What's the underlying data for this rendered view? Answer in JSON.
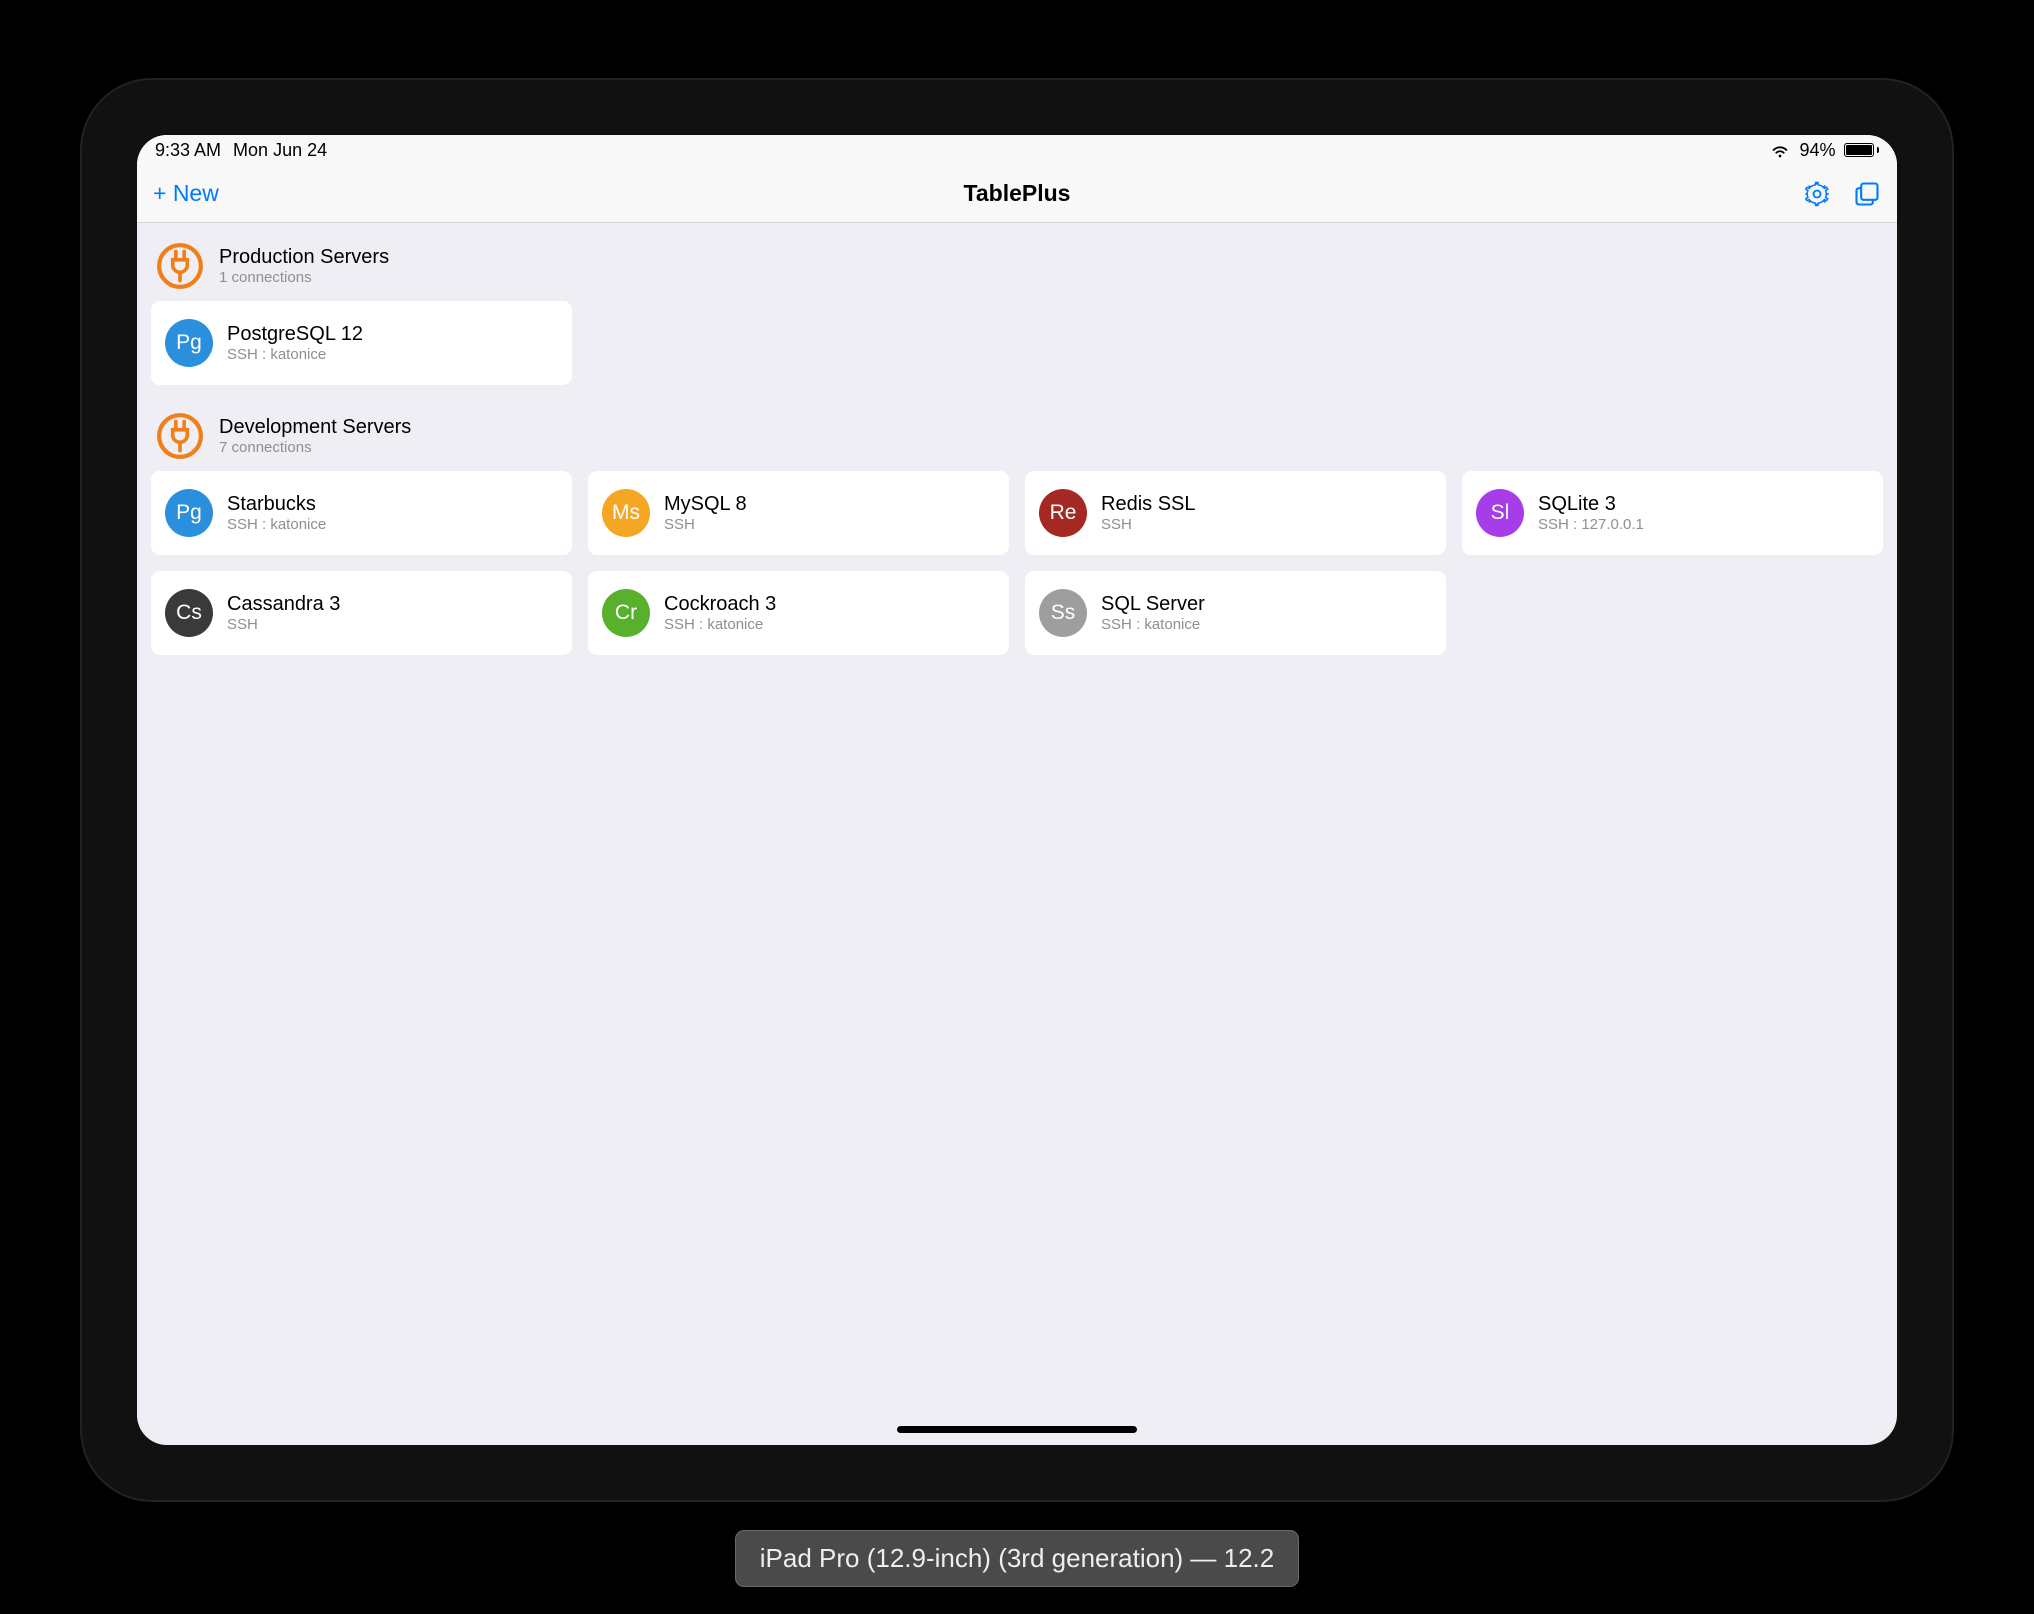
{
  "status": {
    "time": "9:33 AM",
    "date": "Mon Jun 24",
    "battery_pct": "94%"
  },
  "nav": {
    "new_label": "+ New",
    "title": "TablePlus"
  },
  "groups": [
    {
      "name": "Production Servers",
      "subtitle": "1 connections",
      "connections": [
        {
          "name": "PostgreSQL 12",
          "subtitle": "SSH : katonice",
          "badge": "Pg",
          "color": "#2a8fdd"
        }
      ]
    },
    {
      "name": "Development Servers",
      "subtitle": "7 connections",
      "connections": [
        {
          "name": "Starbucks",
          "subtitle": "SSH : katonice",
          "badge": "Pg",
          "color": "#2a8fdd"
        },
        {
          "name": "MySQL 8",
          "subtitle": "SSH",
          "badge": "Ms",
          "color": "#f5a623"
        },
        {
          "name": "Redis SSL",
          "subtitle": "SSH",
          "badge": "Re",
          "color": "#a52923"
        },
        {
          "name": "SQLite 3",
          "subtitle": "SSH : 127.0.0.1",
          "badge": "Sl",
          "color": "#a63de8"
        },
        {
          "name": "Cassandra 3",
          "subtitle": "SSH",
          "badge": "Cs",
          "color": "#3a3a3a"
        },
        {
          "name": "Cockroach 3",
          "subtitle": "SSH : katonice",
          "badge": "Cr",
          "color": "#58b02c"
        },
        {
          "name": "SQL Server",
          "subtitle": "SSH : katonice",
          "badge": "Ss",
          "color": "#9e9e9e"
        }
      ]
    }
  ],
  "caption": "iPad Pro (12.9-inch) (3rd generation) — 12.2"
}
